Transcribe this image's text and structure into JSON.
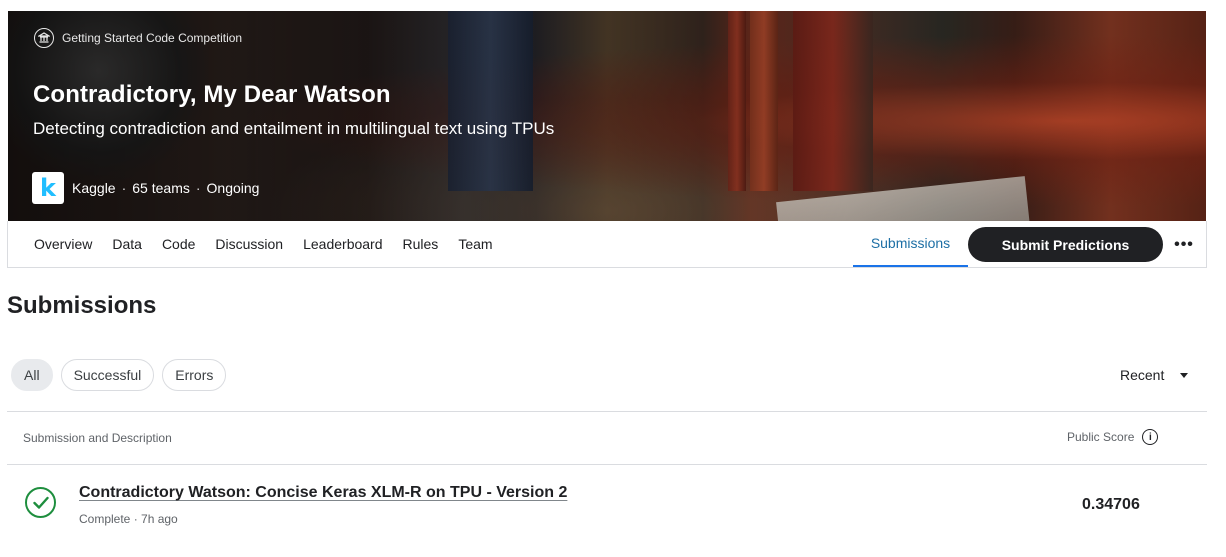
{
  "hero": {
    "tag": "Getting Started Code Competition",
    "tag_icon": "institution-icon",
    "title": "Contradictory, My Dear Watson",
    "subtitle": "Detecting contradiction and entailment in multilingual text using TPUs",
    "host_logo_letter": "k",
    "host": "Kaggle",
    "teams": "65 teams",
    "status": "Ongoing"
  },
  "nav": {
    "tabs": [
      "Overview",
      "Data",
      "Code",
      "Discussion",
      "Leaderboard",
      "Rules",
      "Team"
    ],
    "active_tab": "Submissions",
    "submit_label": "Submit Predictions",
    "more_label": "•••"
  },
  "page": {
    "title": "Submissions"
  },
  "filters": {
    "chips": [
      "All",
      "Successful",
      "Errors"
    ],
    "active": "All",
    "sort_label": "Recent"
  },
  "table": {
    "col_left": "Submission and Description",
    "col_right": "Public Score",
    "rows": [
      {
        "title": "Contradictory Watson: Concise Keras XLM-R on TPU - Version 2",
        "meta": "Complete · 7h ago",
        "score": "0.34706",
        "status_icon": "check-circle-icon"
      }
    ]
  },
  "colors": {
    "accent": "#1d6fa5",
    "success": "#1e8e3e",
    "button_dark": "#202124",
    "kaggle_blue": "#20beff"
  }
}
